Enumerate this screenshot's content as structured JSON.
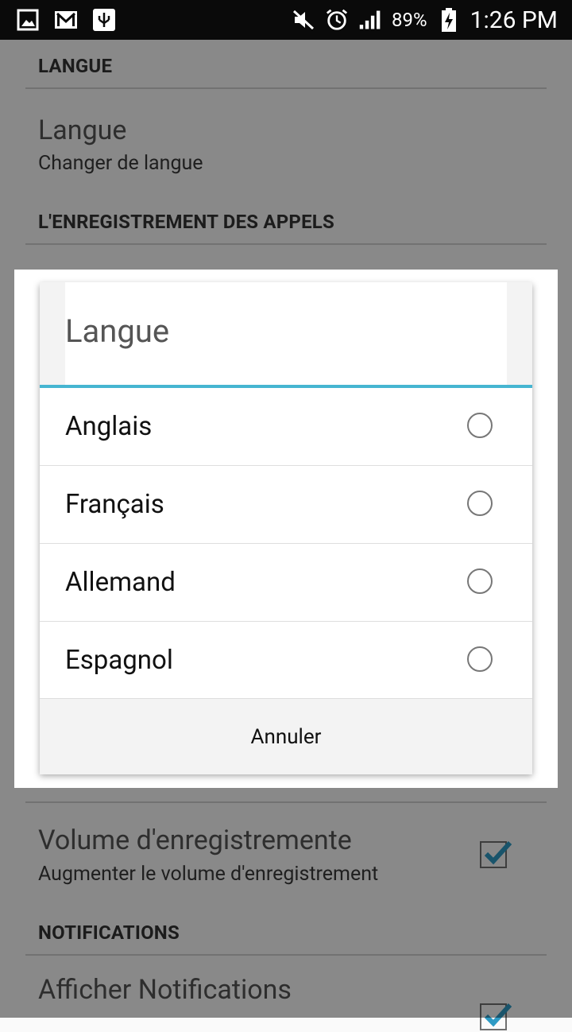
{
  "status_bar": {
    "battery": "89%",
    "time": "1:26 PM",
    "icons": [
      "image-notification-icon",
      "gmail-icon",
      "usb-icon",
      "mute-icon",
      "alarm-icon",
      "signal-icon",
      "battery-charging-icon"
    ]
  },
  "settings": {
    "section_langue": "LANGUE",
    "langue_title": "Langue",
    "langue_subtitle": "Changer de langue",
    "section_recording": "L'ENREGISTREMENT DES APPELS",
    "volume_title": "Volume d'enregistremente",
    "volume_subtitle": "Augmenter le volume d'enregistrement",
    "volume_checked": true,
    "section_notifications": "NOTIFICATIONS",
    "notif_title": "Afficher Notifications",
    "notif_checked": true
  },
  "dialog": {
    "title": "Langue",
    "options": [
      {
        "label": "Anglais",
        "selected": false
      },
      {
        "label": "Français",
        "selected": false
      },
      {
        "label": "Allemand",
        "selected": false
      },
      {
        "label": "Espagnol",
        "selected": false
      }
    ],
    "cancel_label": "Annuler",
    "accent_color": "#46b5d1"
  }
}
